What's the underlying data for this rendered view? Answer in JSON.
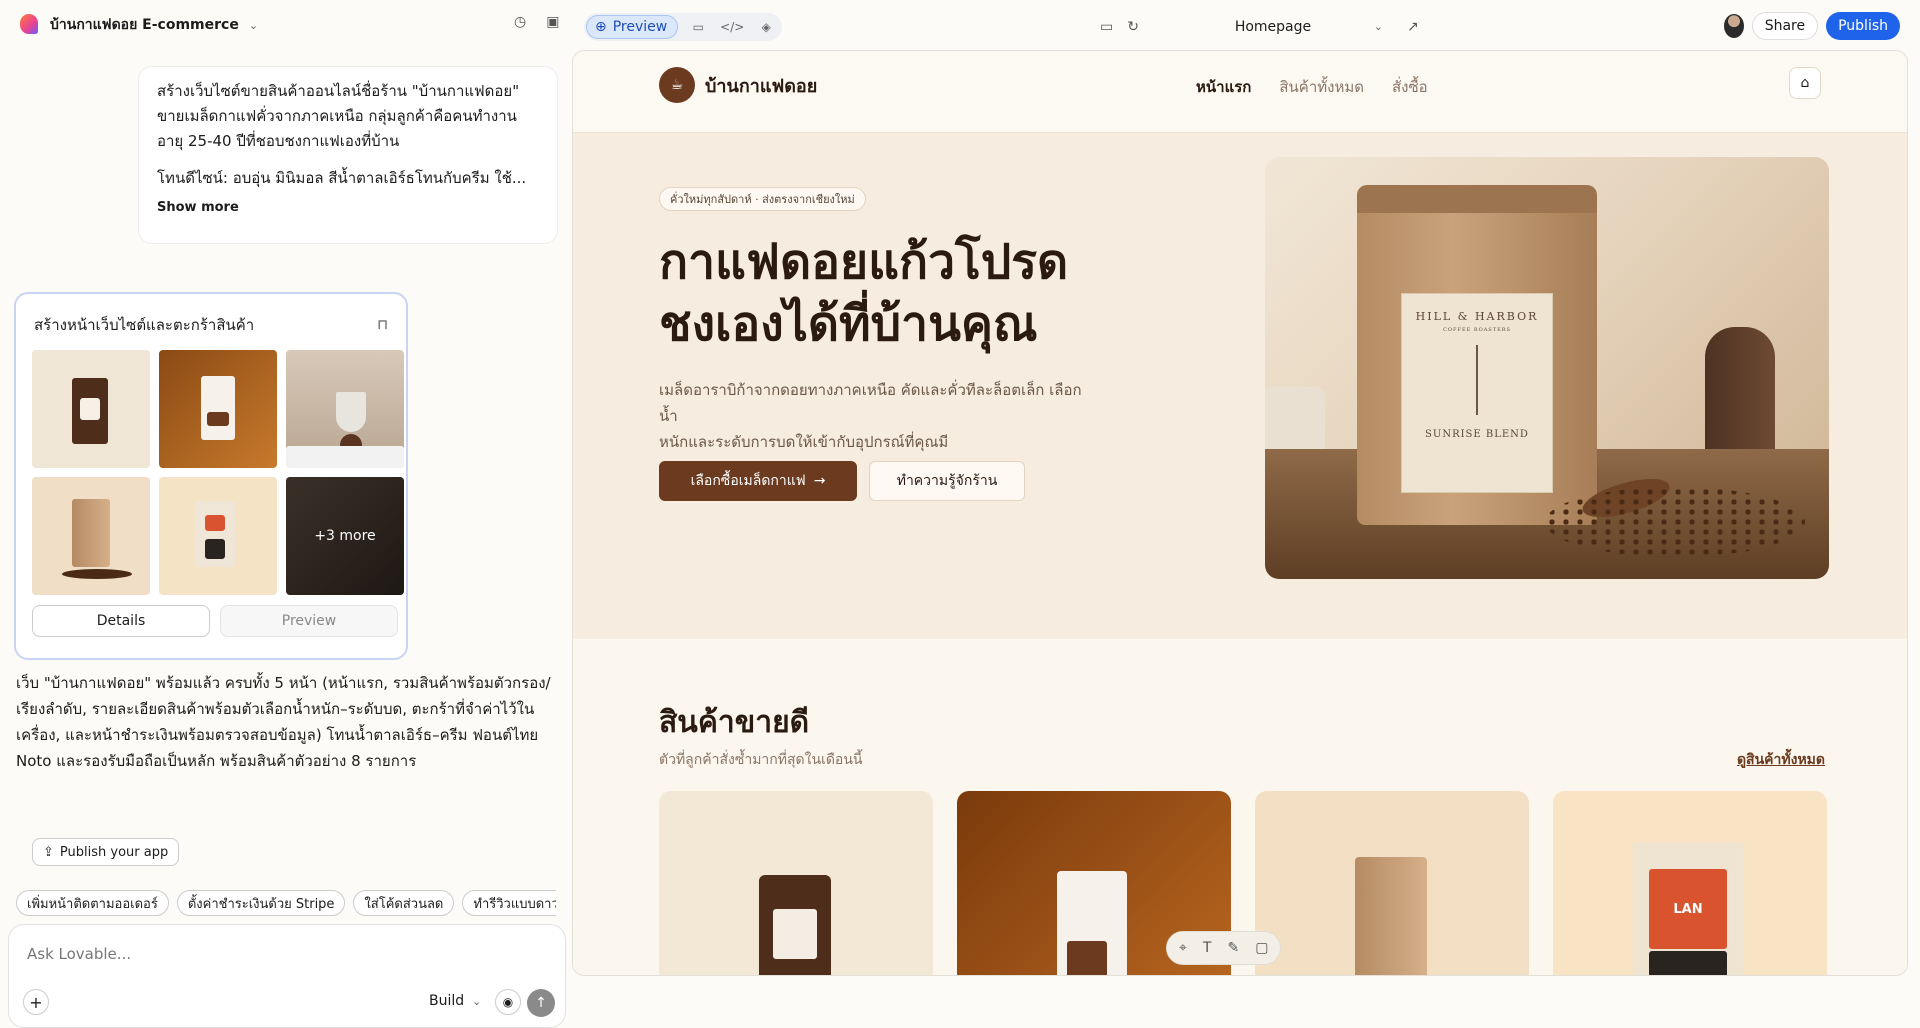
{
  "topbar": {
    "project_name": "บ้านกาแฟดอย E-commerce",
    "preview_tab": "Preview",
    "page_select": "Homepage",
    "share": "Share",
    "publish": "Publish"
  },
  "chat": {
    "prompt_lines": [
      "สร้างเว็บไซต์ขายสินค้าออนไลน์ชื่อร้าน \"บ้านกาแฟดอย\"",
      "ขายเมล็ดกาแฟคั่วจากภาคเหนือ กลุ่มลูกค้าคือคนทำงาน",
      "อายุ 25-40 ปีที่ชอบชงกาแฟเองที่บ้าน",
      "โทนดีไซน์: อบอุ่น มินิมอล สีน้ำตาลเอิร์ธโทนกับครีม ใช้..."
    ],
    "show_more": "Show more",
    "card_title": "สร้างหน้าเว็บไซต์และตะกร้าสินค้า",
    "more_label": "+3 more",
    "details_btn": "Details",
    "preview_btn": "Preview",
    "reply_lines": [
      "เว็บ \"บ้านกาแฟดอย\" พร้อมแล้ว ครบทั้ง 5 หน้า (หน้าแรก, รวมสินค้าพร้อมตัวกรอง/",
      "เรียงลำดับ, รายละเอียดสินค้าพร้อมตัวเลือกน้ำหนัก–ระดับบด, ตะกร้าที่จำค่าไว้ใน",
      "เครื่อง, และหน้าชำระเงินพร้อมตรวจสอบข้อมูล) โทนน้ำตาลเอิร์ธ–ครีม ฟอนต์ไทย",
      "Noto และรองรับมือถือเป็นหลัก พร้อมสินค้าตัวอย่าง 8 รายการ"
    ],
    "publish_app": "Publish your app",
    "suggestions": [
      "เพิ่มหน้าติดตามออเดอร์",
      "ตั้งค่าชำระเงินด้วย Stripe",
      "ใส่โค้ดส่วนลด",
      "ทำรีวิวแบบดาว"
    ],
    "composer_placeholder": "Ask Lovable...",
    "mode": "Build"
  },
  "site": {
    "brand": "บ้านกาแฟดอย",
    "nav": [
      "หน้าแรก",
      "สินค้าทั้งหมด",
      "สั่งซื้อ"
    ],
    "hero_pill": "คั่วใหม่ทุกสัปดาห์ · ส่งตรงจากเชียงใหม่",
    "hero_title_1": "กาแฟดอยแก้วโปรด",
    "hero_title_2": "ชงเองได้ที่บ้านคุณ",
    "hero_lead_1": "เมล็ดอาราบิก้าจากดอยทางภาคเหนือ คัดและคั่วทีละล็อตเล็ก เลือกน้ำ",
    "hero_lead_2": "หนักและระดับการบดให้เข้ากับอุปกรณ์ที่คุณมี",
    "cta_primary": "เลือกซื้อเมล็ดกาแฟ",
    "cta_secondary": "ทำความรู้จักร้าน",
    "pouch_brand": "HILL & HARBOR",
    "pouch_sub": "COFFEE ROASTERS",
    "pouch_blend": "SUNRISE BLEND",
    "best_title": "สินค้าขายดี",
    "best_sub": "ตัวที่ลูกค้าสั่งซ้ำมากที่สุดในเดือนนี้",
    "see_all": "ดูสินค้าทั้งหมด",
    "prod4_label": "LAN"
  },
  "colors": {
    "accent": "#1e63e9",
    "brand_brown": "#6b3a1f",
    "cream": "#f6ede0"
  }
}
